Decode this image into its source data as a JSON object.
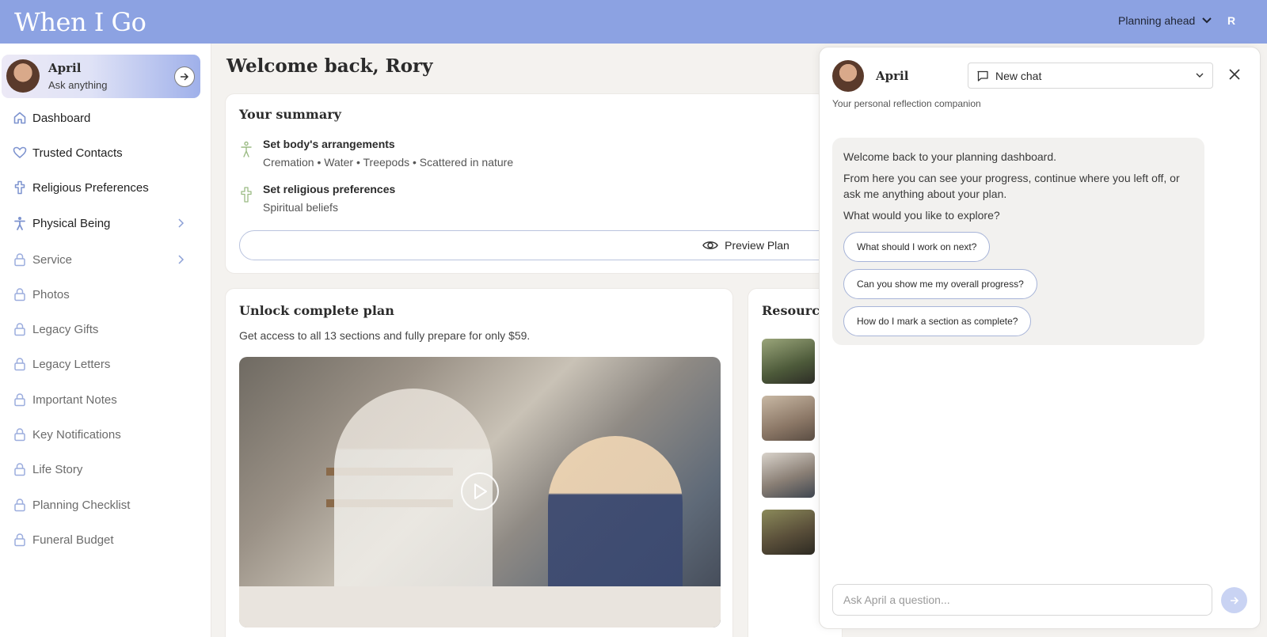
{
  "header": {
    "logo": "When I Go",
    "plan_menu": "Planning ahead",
    "user_initial": "R"
  },
  "sidebar": {
    "assistant": {
      "name": "April",
      "subtitle": "Ask anything"
    },
    "items": [
      {
        "label": "Dashboard",
        "icon": "home-icon"
      },
      {
        "label": "Trusted Contacts",
        "icon": "heart-icon"
      },
      {
        "label": "Religious Preferences",
        "icon": "cross-icon"
      },
      {
        "label": "Physical Being",
        "icon": "person-icon"
      },
      {
        "label": "Service",
        "icon": "lock-icon"
      },
      {
        "label": "Photos",
        "icon": "lock-icon"
      },
      {
        "label": "Legacy Gifts",
        "icon": "lock-icon"
      },
      {
        "label": "Legacy Letters",
        "icon": "lock-icon"
      },
      {
        "label": "Important Notes",
        "icon": "lock-icon"
      },
      {
        "label": "Key Notifications",
        "icon": "lock-icon"
      },
      {
        "label": "Life Story",
        "icon": "lock-icon"
      },
      {
        "label": "Planning Checklist",
        "icon": "lock-icon"
      },
      {
        "label": "Funeral Budget",
        "icon": "lock-icon"
      }
    ]
  },
  "main": {
    "welcome": "Welcome back, Rory",
    "summary": {
      "title": "Your summary",
      "rows": [
        {
          "title": "Set body's arrangements",
          "detail": "Cremation • Water • Treepods • Scattered in nature"
        },
        {
          "title": "Set religious preferences",
          "detail": "Spiritual beliefs"
        }
      ],
      "preview_label": "Preview Plan"
    },
    "unlock": {
      "title": "Unlock complete plan",
      "description": "Get access to all 13 sections and fully prepare for only $59."
    },
    "resources": {
      "title": "Resource"
    }
  },
  "chat": {
    "name": "April",
    "selector": "New chat",
    "subtitle": "Your personal reflection companion",
    "messages": [
      "Welcome back to your planning dashboard.",
      "From here you can see your progress, continue where you left off, or ask me anything about your plan.",
      "What would you like to explore?"
    ],
    "suggestions": [
      "What should I work on next?",
      "Can you show me my overall progress?",
      "How do I mark a section as complete?"
    ],
    "input_placeholder": "Ask April a question..."
  },
  "colors": {
    "topbar": "#8ca2e2",
    "accent": "#a7b4d8",
    "send_button": "#c9d3f3"
  }
}
